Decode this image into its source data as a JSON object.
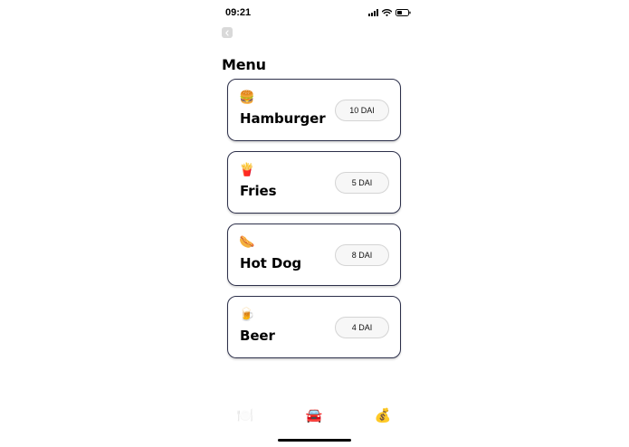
{
  "status": {
    "time": "09:21",
    "icons": [
      "cellular-signal-icon",
      "wifi-icon",
      "battery-icon"
    ]
  },
  "header": {
    "back_icon": "chevron-left-icon",
    "title": "Menu"
  },
  "menu": {
    "items": [
      {
        "emoji": "🍔",
        "icon": "hamburger-icon",
        "name": "Hamburger",
        "price": "10 DAI"
      },
      {
        "emoji": "🍟",
        "icon": "fries-icon",
        "name": "Fries",
        "price": "5 DAI"
      },
      {
        "emoji": "🌭",
        "icon": "hot-dog-icon",
        "name": "Hot Dog",
        "price": "8 DAI"
      },
      {
        "emoji": "🍺",
        "icon": "beer-icon",
        "name": "Beer",
        "price": "4 DAI"
      }
    ]
  },
  "tabbar": {
    "tabs": [
      {
        "emoji": "🍽️",
        "icon": "plate-cutlery-icon"
      },
      {
        "emoji": "🚘",
        "icon": "car-icon"
      },
      {
        "emoji": "💰",
        "icon": "money-bag-icon"
      }
    ]
  },
  "colors": {
    "card_border": "#2c2f4a",
    "pill_background": "#f7f7f7",
    "pill_border": "#d4d4d4",
    "text": "#000000"
  }
}
